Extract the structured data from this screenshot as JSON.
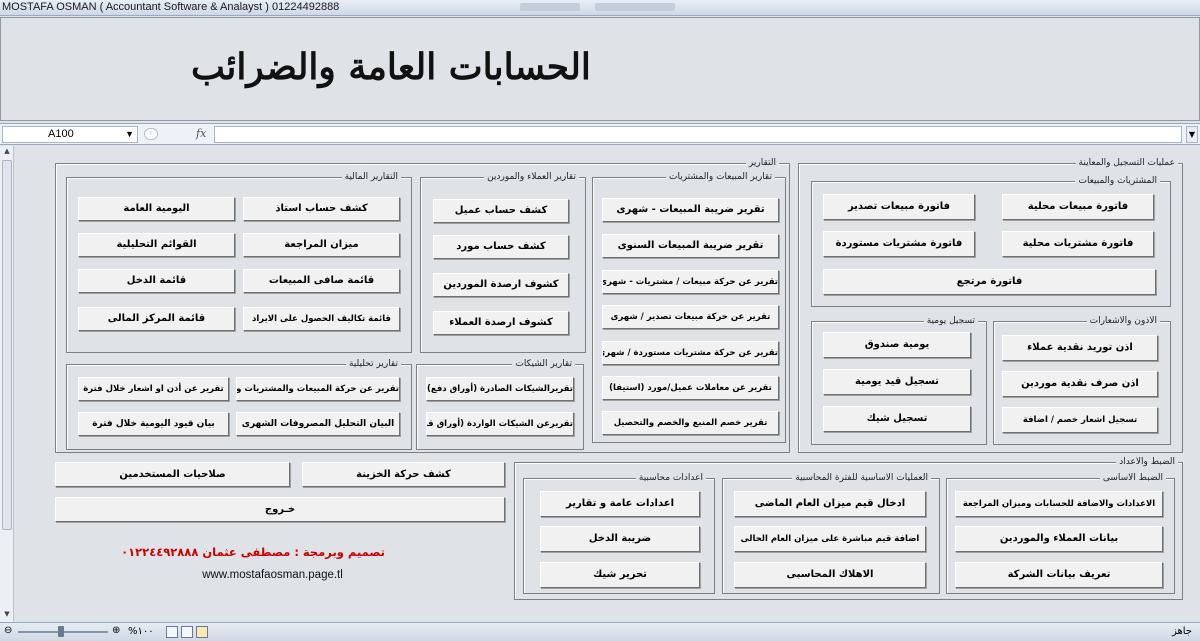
{
  "window": {
    "title": "MOSTAFA OSMAN ( Accountant Software &  Analayst ) 01224492888"
  },
  "header": {
    "title": "الحسابات العامة والضرائب"
  },
  "formula_bar": {
    "name_box": "A100",
    "fx": "fx",
    "value": ""
  },
  "reports": {
    "title": "التقارير",
    "financial": {
      "title": "التقارير المالية",
      "buttons": [
        "كشف حساب استاذ",
        "اليومية العامة",
        "ميزان المراجعة",
        "القوائم التحليلية",
        "قائمة صافى المبيعات",
        "قائمة الدخل",
        "قائمة تكاليف الحصول على الايراد",
        "قائمة المركز المالى"
      ]
    },
    "customers_suppliers": {
      "title": "تقارير العملاء والموردين",
      "buttons": [
        "كشف حساب عميل",
        "كشف حساب مورد",
        "كشوف ارصدة الموردين",
        "كشوف ارصدة العملاء"
      ]
    },
    "sales_purchases": {
      "title": "تقارير المبيعات والمشتريات",
      "buttons": [
        "تقرير ضريبة المبيعات - شهرى",
        "تقرير ضريبة المبيعات السنوى",
        "تقرير عن حركة مبيعات / مشتريات - شهرى",
        "تقرير عن حركة مبيعات تصدير / شهرى",
        "تقرير عن حركة مشتريات مستوردة / شهرى",
        "تقرير عن معاملات عميل/مورد (استيفا)",
        "تقرير خصم المنبع والخصم والتحصيل"
      ]
    },
    "analytical": {
      "title": "تقارير تحليلية",
      "buttons": [
        "تقرير عن حركة المبيعات والمشتريات والمرتجع",
        "تقرير عن أذن او اشعار خلال فترة",
        "البيان التحليل المصروفات الشهرى",
        "بيان قيود اليومية خلال فترة"
      ]
    },
    "cheques": {
      "title": "تقارير الشيكات",
      "buttons": [
        "تقريرالشيكات الصادرة (أوراق دفع)",
        "تقريرعن الشيكات الواردة (أوراق قبض)"
      ]
    }
  },
  "registration": {
    "title": "عمليات التسجيل والمعاينة",
    "purchases_sales": {
      "title": "المشتريات والمبيعات",
      "buttons": [
        "فاتورة مبيعات محلية",
        "فاتورة مبيعات تصدير",
        "فاتورة مشتريات محلية",
        "فاتورة مشتريات مستوردة",
        "فاتورة مرتجع"
      ]
    },
    "vouchers": {
      "title": "الاذون والاشعارات",
      "buttons": [
        "اذن توريد نقدية  عملاء",
        "اذن صرف نقدية موردين",
        "تسجيل اشعار خصم / اضافة"
      ]
    },
    "daily": {
      "title": "تسجيل يومية",
      "buttons": [
        "يومية صندوق",
        "تسجيل قيد يومية",
        "تسجيل شيك"
      ]
    }
  },
  "setup": {
    "title": "الضبط والاعداد",
    "basic": {
      "title": "الضبط الاساسى",
      "buttons": [
        "الاعدادات والاضافة للحسابات وميزان المراجعة",
        "بيانات العملاء والموردين",
        "تعريف بيانات الشركة"
      ]
    },
    "period_ops": {
      "title": "العمليات الاساسية للفترة المحاسبية",
      "buttons": [
        "ادخال قيم ميزان العام الماضى",
        "اضافة قيم مباشرة على ميزان العام الحالى",
        "الاهلاك المحاسبى"
      ]
    },
    "accounting_settings": {
      "title": "اعدادات محاسبية",
      "buttons": [
        "اعدادات عامة و تقارير",
        "ضريبة الدخل",
        "تحرير شيك"
      ]
    }
  },
  "misc": {
    "treasury": "كشف حركة الخزينة",
    "permissions": "صلاحيات المستخدمين",
    "exit": "خـروج",
    "credit": "تصميم وبرمجة : مصطفى عثمان ٠١٢٢٤٤٩٢٨٨٨",
    "website": "www.mostafaosman.page.tl"
  },
  "status_bar": {
    "ready": "جاهز",
    "zoom": "%١٠٠",
    "zoom_level_percent": 100
  }
}
